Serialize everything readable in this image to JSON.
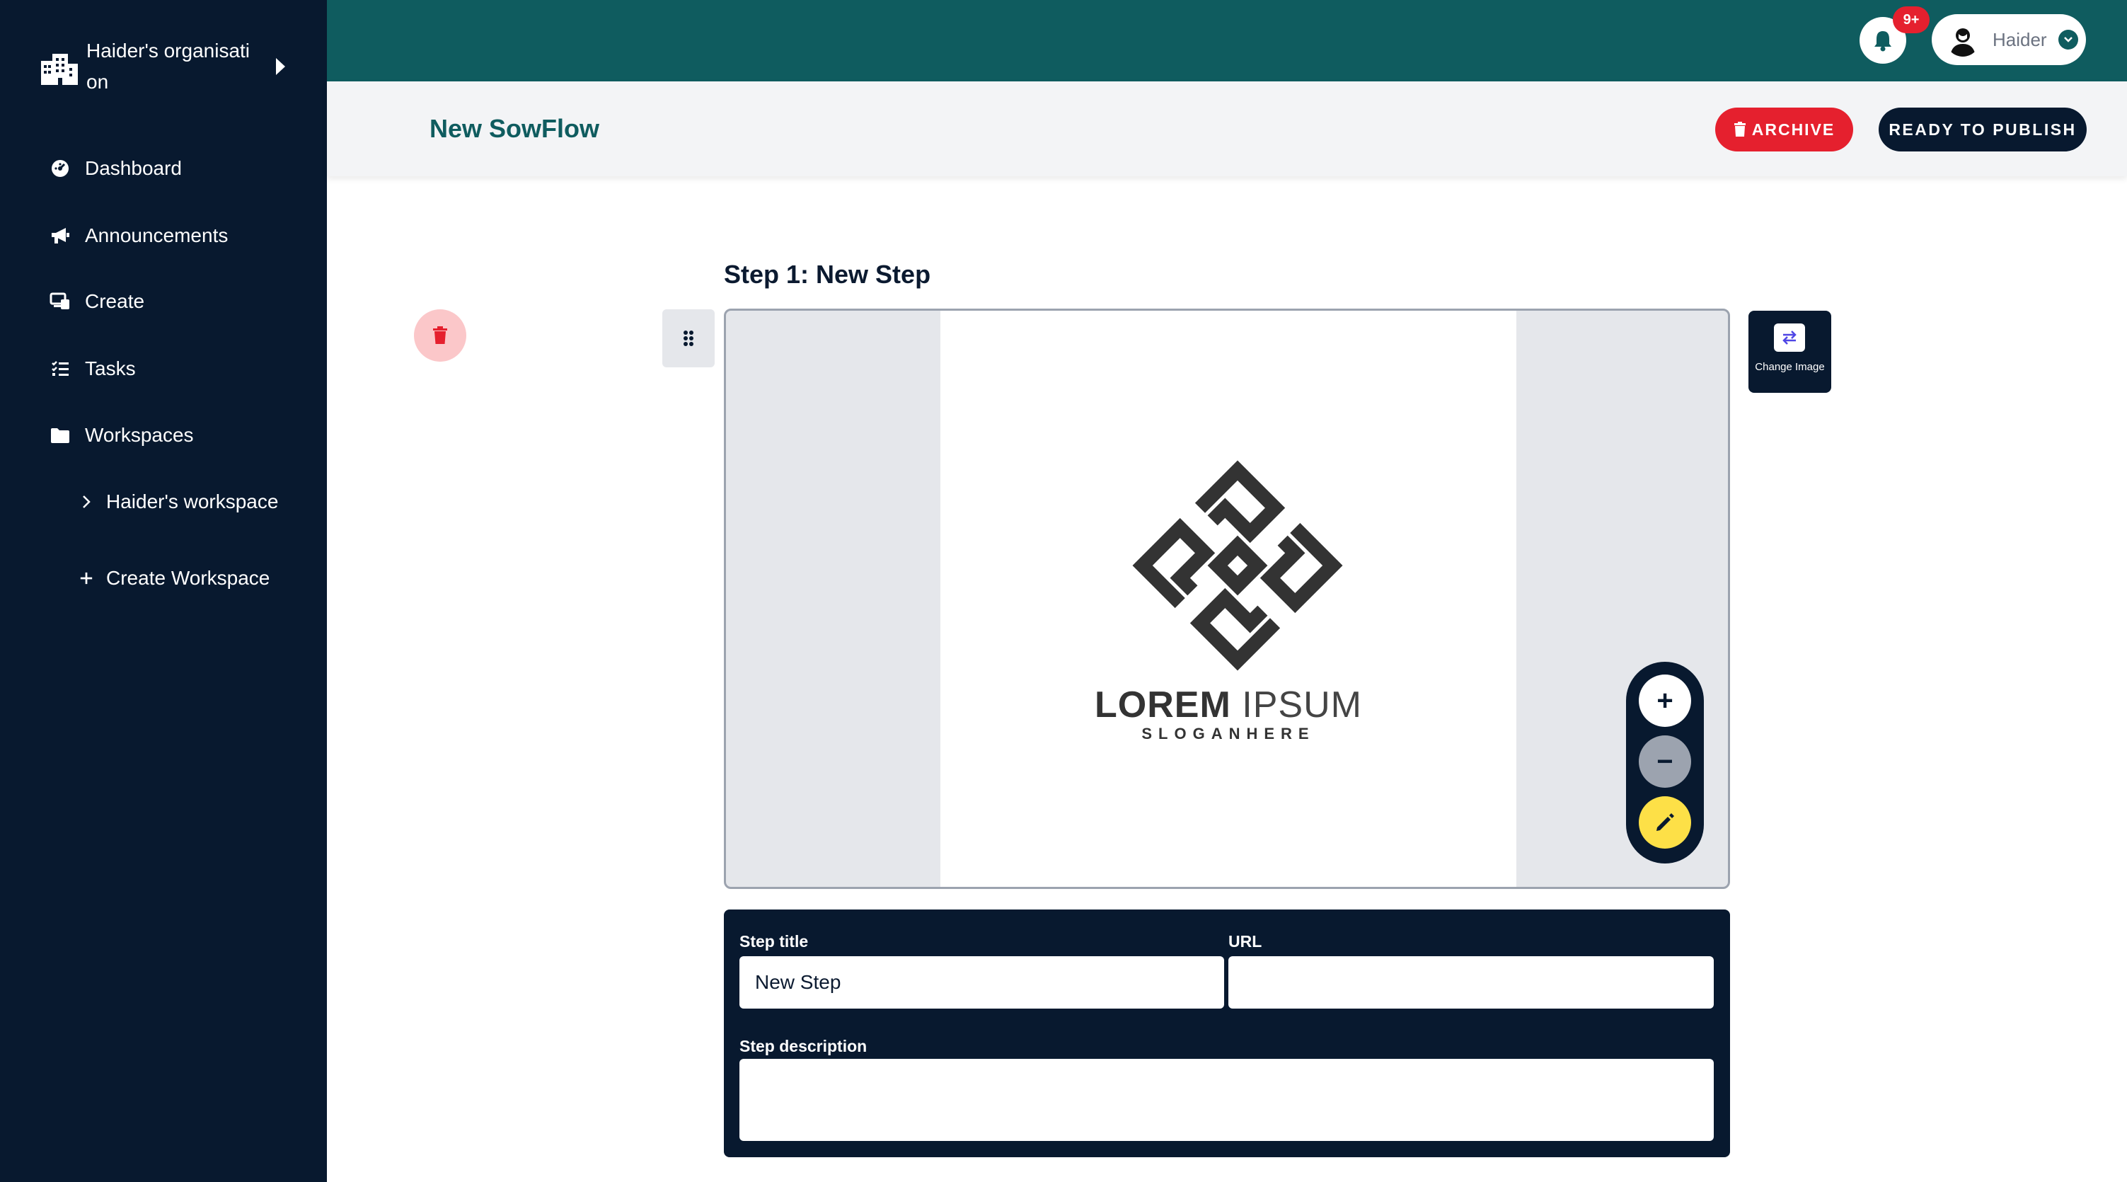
{
  "sidebar": {
    "org_name": "Haider's organisati on",
    "items": [
      {
        "label": "Dashboard",
        "icon": "dashboard-icon"
      },
      {
        "label": "Announcements",
        "icon": "megaphone-icon"
      },
      {
        "label": "Create",
        "icon": "create-icon"
      },
      {
        "label": "Tasks",
        "icon": "tasks-icon"
      },
      {
        "label": "Workspaces",
        "icon": "folder-icon"
      }
    ],
    "workspace": "Haider's workspace",
    "create_workspace": "Create Workspace"
  },
  "topbar": {
    "notifications_badge": "9+",
    "user_name": "Haider"
  },
  "header": {
    "title": "New SowFlow",
    "archive_label": "ARCHIVE",
    "publish_label": "READY TO PUBLISH"
  },
  "step": {
    "heading": "Step 1: New Step",
    "change_image_label": "Change Image",
    "logo_word_bold": "LOREM",
    "logo_word_light": "IPSUM",
    "logo_slogan": "SLOGANHERE",
    "zoom_in": "+",
    "zoom_out": "−"
  },
  "form": {
    "title_label": "Step title",
    "title_value": "New Step",
    "url_label": "URL",
    "url_value": "",
    "description_label": "Step description",
    "description_value": ""
  },
  "colors": {
    "sidebar": "#08192f",
    "topbar": "#0f5c5f",
    "danger": "#e5202e",
    "edit": "#fde047"
  }
}
